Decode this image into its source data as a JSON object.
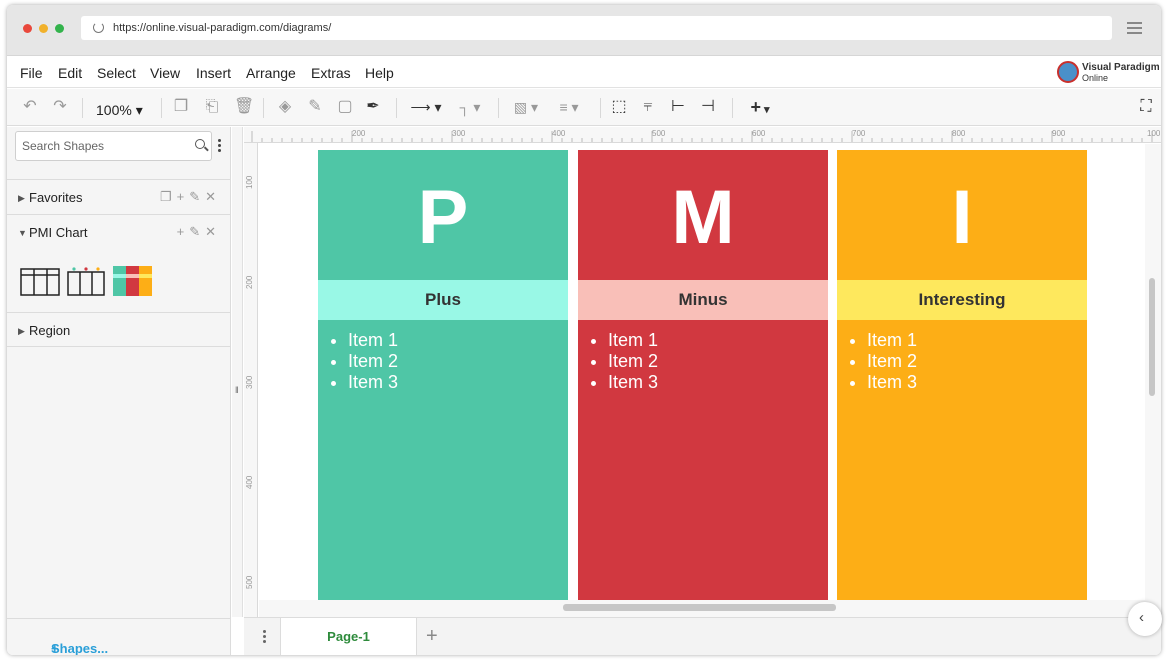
{
  "browser": {
    "url": "https://online.visual-paradigm.com/diagrams/",
    "traffic_lights": [
      "#e9483c",
      "#f1b12b",
      "#33b34c"
    ]
  },
  "app": {
    "logo_line1": "Visual Paradigm",
    "logo_line2": "Online"
  },
  "menu": [
    "File",
    "Edit",
    "Select",
    "View",
    "Insert",
    "Arrange",
    "Extras",
    "Help"
  ],
  "toolbar": {
    "zoom": "100%",
    "icons": [
      "undo-icon",
      "redo-icon",
      "copy-icon",
      "paste-icon",
      "delete-icon",
      "fill-color-icon",
      "line-color-icon",
      "shadow-icon",
      "format-painter-icon",
      "connector-icon",
      "waypoint-icon",
      "to-front-icon",
      "align-icon",
      "fit-icon",
      "distribute-icon",
      "align-left-icon",
      "align-center-icon",
      "insert-icon",
      "fullscreen-icon"
    ]
  },
  "sidebar": {
    "search_placeholder": "Search Shapes",
    "sections": [
      {
        "label": "Favorites",
        "expanded": false
      },
      {
        "label": "PMI Chart",
        "expanded": true
      },
      {
        "label": "Region",
        "expanded": false
      }
    ],
    "shapes_link": "Shapes..."
  },
  "rulers": {
    "top": [
      "200",
      "300",
      "400",
      "500",
      "600",
      "700",
      "800",
      "900",
      "100"
    ],
    "left": [
      "100",
      "200",
      "300",
      "400",
      "500"
    ]
  },
  "pmi": [
    {
      "letter": "P",
      "title": "Plus",
      "items": [
        "Item 1",
        "Item 2",
        "Item 3"
      ],
      "color": "#4fc6a6",
      "band_color": "#99f8e6"
    },
    {
      "letter": "M",
      "title": "Minus",
      "items": [
        "Item 1",
        "Item 2",
        "Item 3"
      ],
      "color": "#d13840",
      "band_color": "#f9bfb8"
    },
    {
      "letter": "I",
      "title": "Interesting",
      "items": [
        "Item 1",
        "Item 2",
        "Item 3"
      ],
      "color": "#fdae16",
      "band_color": "#fee85d"
    }
  ],
  "pages": {
    "tabs": [
      "Page-1"
    ]
  }
}
